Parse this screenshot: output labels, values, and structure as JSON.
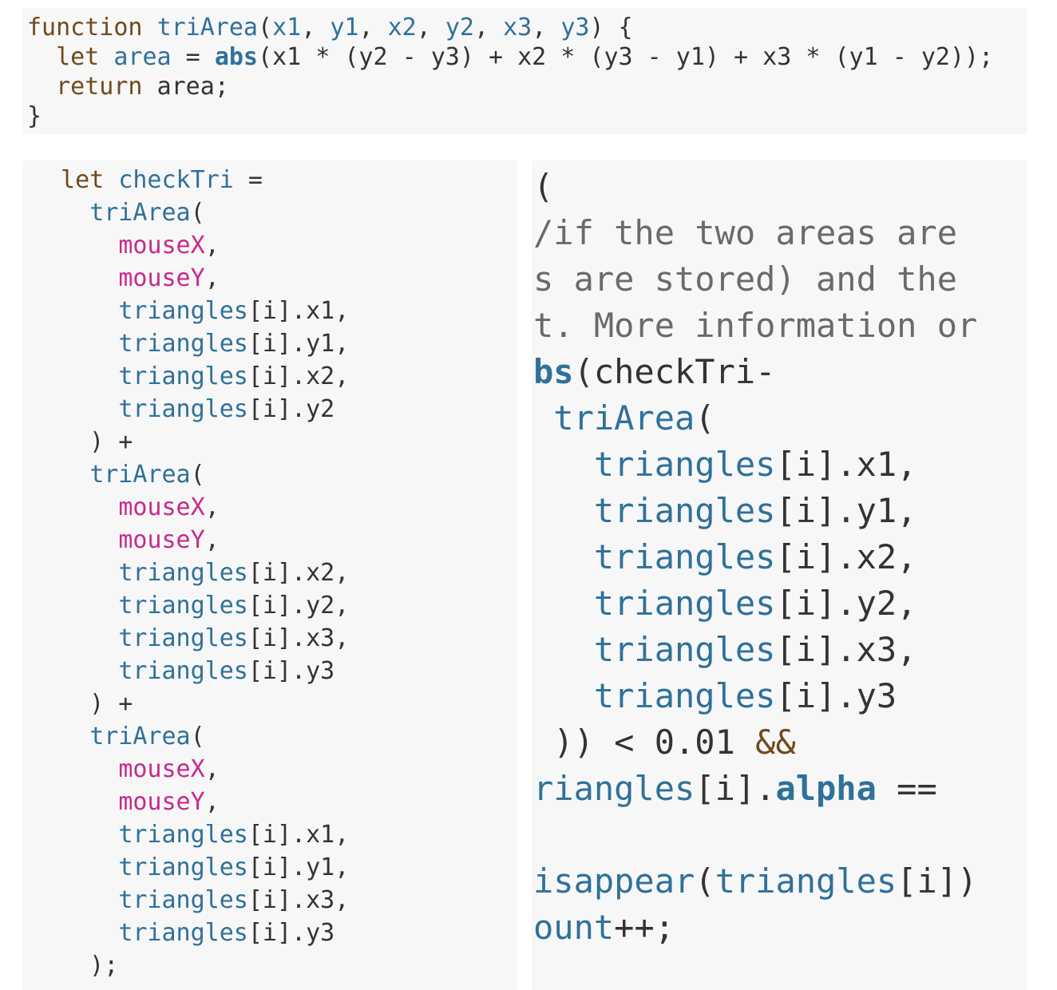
{
  "colors": {
    "panel_bg": "#f7f7f7",
    "text": "#333333",
    "keyword": "#704a1c",
    "function": "#2f7199",
    "variable": "#c72a8c",
    "comment": "#6a6a6a"
  },
  "panels": [
    {
      "id": "top",
      "lines": [
        [
          [
            "function ",
            "kw"
          ],
          [
            "triArea",
            "fn"
          ],
          [
            "(",
            "p"
          ],
          [
            "x1",
            "fn"
          ],
          [
            ", ",
            "p"
          ],
          [
            "y1",
            "fn"
          ],
          [
            ", ",
            "p"
          ],
          [
            "x2",
            "fn"
          ],
          [
            ", ",
            "p"
          ],
          [
            "y2",
            "fn"
          ],
          [
            ", ",
            "p"
          ],
          [
            "x3",
            "fn"
          ],
          [
            ", ",
            "p"
          ],
          [
            "y3",
            "fn"
          ],
          [
            ") {",
            "p"
          ]
        ],
        [
          [
            "  ",
            "p"
          ],
          [
            "let ",
            "kw"
          ],
          [
            "area",
            "fn"
          ],
          [
            " = ",
            "p"
          ],
          [
            "abs",
            "bold"
          ],
          [
            "(x1 * (y2 - y3) + x2 * (y3 - y1) + x3 * (y1 - y2));",
            "p"
          ]
        ],
        [
          [
            "  ",
            "p"
          ],
          [
            "return ",
            "kw"
          ],
          [
            "area;",
            "p"
          ]
        ],
        [
          [
            "}",
            "p"
          ]
        ]
      ]
    },
    {
      "id": "left",
      "lines": [
        [
          [
            " let ",
            "kw"
          ],
          [
            "checkTri",
            "fn"
          ],
          [
            " =",
            "p"
          ]
        ],
        [
          [
            "   ",
            "p"
          ],
          [
            "triArea",
            "fn"
          ],
          [
            "(",
            "p"
          ]
        ],
        [
          [
            "     ",
            "p"
          ],
          [
            "mouseX",
            "var"
          ],
          [
            ",",
            "p"
          ]
        ],
        [
          [
            "     ",
            "p"
          ],
          [
            "mouseY",
            "var"
          ],
          [
            ",",
            "p"
          ]
        ],
        [
          [
            "     ",
            "p"
          ],
          [
            "triangles",
            "fn"
          ],
          [
            "[i].x1,",
            "p"
          ]
        ],
        [
          [
            "     ",
            "p"
          ],
          [
            "triangles",
            "fn"
          ],
          [
            "[i].y1,",
            "p"
          ]
        ],
        [
          [
            "     ",
            "p"
          ],
          [
            "triangles",
            "fn"
          ],
          [
            "[i].x2,",
            "p"
          ]
        ],
        [
          [
            "     ",
            "p"
          ],
          [
            "triangles",
            "fn"
          ],
          [
            "[i].y2",
            "p"
          ]
        ],
        [
          [
            "   ) +",
            "p"
          ]
        ],
        [
          [
            "   ",
            "p"
          ],
          [
            "triArea",
            "fn"
          ],
          [
            "(",
            "p"
          ]
        ],
        [
          [
            "     ",
            "p"
          ],
          [
            "mouseX",
            "var"
          ],
          [
            ",",
            "p"
          ]
        ],
        [
          [
            "     ",
            "p"
          ],
          [
            "mouseY",
            "var"
          ],
          [
            ",",
            "p"
          ]
        ],
        [
          [
            "     ",
            "p"
          ],
          [
            "triangles",
            "fn"
          ],
          [
            "[i].x2,",
            "p"
          ]
        ],
        [
          [
            "     ",
            "p"
          ],
          [
            "triangles",
            "fn"
          ],
          [
            "[i].y2,",
            "p"
          ]
        ],
        [
          [
            "     ",
            "p"
          ],
          [
            "triangles",
            "fn"
          ],
          [
            "[i].x3,",
            "p"
          ]
        ],
        [
          [
            "     ",
            "p"
          ],
          [
            "triangles",
            "fn"
          ],
          [
            "[i].y3",
            "p"
          ]
        ],
        [
          [
            "   ) +",
            "p"
          ]
        ],
        [
          [
            "   ",
            "p"
          ],
          [
            "triArea",
            "fn"
          ],
          [
            "(",
            "p"
          ]
        ],
        [
          [
            "     ",
            "p"
          ],
          [
            "mouseX",
            "var"
          ],
          [
            ",",
            "p"
          ]
        ],
        [
          [
            "     ",
            "p"
          ],
          [
            "mouseY",
            "var"
          ],
          [
            ",",
            "p"
          ]
        ],
        [
          [
            "     ",
            "p"
          ],
          [
            "triangles",
            "fn"
          ],
          [
            "[i].x1,",
            "p"
          ]
        ],
        [
          [
            "     ",
            "p"
          ],
          [
            "triangles",
            "fn"
          ],
          [
            "[i].y1,",
            "p"
          ]
        ],
        [
          [
            "     ",
            "p"
          ],
          [
            "triangles",
            "fn"
          ],
          [
            "[i].x3,",
            "p"
          ]
        ],
        [
          [
            "     ",
            "p"
          ],
          [
            "triangles",
            "fn"
          ],
          [
            "[i].y3",
            "p"
          ]
        ],
        [
          [
            "   );",
            "p"
          ]
        ]
      ]
    },
    {
      "id": "right",
      "lines": [
        [
          [
            "(",
            "p"
          ]
        ],
        [
          [
            "/if the two areas are",
            "cmt"
          ]
        ],
        [
          [
            "s are stored) and the",
            "cmt"
          ]
        ],
        [
          [
            "t. More information or",
            "cmt"
          ]
        ],
        [
          [
            "bs",
            "bold"
          ],
          [
            "(checkTri-",
            "p"
          ]
        ],
        [
          [
            " ",
            "p"
          ],
          [
            "triArea",
            "fn"
          ],
          [
            "(",
            "p"
          ]
        ],
        [
          [
            "   ",
            "p"
          ],
          [
            "triangles",
            "fn"
          ],
          [
            "[i].x1,",
            "p"
          ]
        ],
        [
          [
            "   ",
            "p"
          ],
          [
            "triangles",
            "fn"
          ],
          [
            "[i].y1,",
            "p"
          ]
        ],
        [
          [
            "   ",
            "p"
          ],
          [
            "triangles",
            "fn"
          ],
          [
            "[i].x2,",
            "p"
          ]
        ],
        [
          [
            "   ",
            "p"
          ],
          [
            "triangles",
            "fn"
          ],
          [
            "[i].y2,",
            "p"
          ]
        ],
        [
          [
            "   ",
            "p"
          ],
          [
            "triangles",
            "fn"
          ],
          [
            "[i].x3,",
            "p"
          ]
        ],
        [
          [
            "   ",
            "p"
          ],
          [
            "triangles",
            "fn"
          ],
          [
            "[i].y3",
            "p"
          ]
        ],
        [
          [
            " )) < 0.01 ",
            "p"
          ],
          [
            "&&",
            "kw"
          ]
        ],
        [
          [
            "riangles",
            "fn"
          ],
          [
            "[i].",
            "p"
          ],
          [
            "alpha",
            "bold"
          ],
          [
            " ==",
            "p"
          ]
        ],
        [
          [
            "",
            "p"
          ]
        ],
        [
          [
            "isappear",
            "fn"
          ],
          [
            "(",
            "p"
          ],
          [
            "triangles",
            "fn"
          ],
          [
            "[i])",
            "p"
          ]
        ],
        [
          [
            "ount",
            "fn"
          ],
          [
            "++;",
            "p"
          ]
        ]
      ]
    }
  ]
}
